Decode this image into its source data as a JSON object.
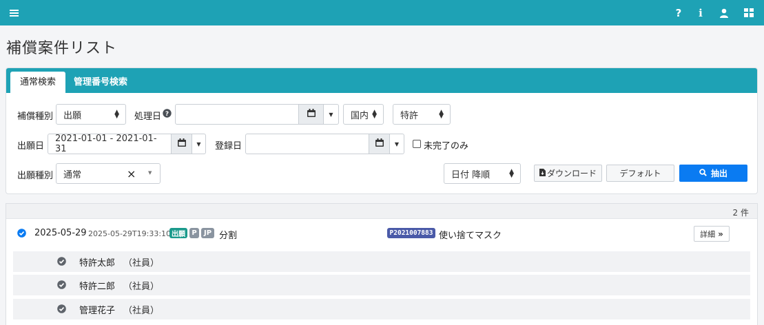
{
  "nav": {
    "icons": [
      "menu-icon",
      "help-icon",
      "info-icon",
      "user-icon",
      "apps-icon"
    ],
    "bg_color": "#1ea2b5"
  },
  "page_title": "補償案件リスト",
  "tabs": [
    {
      "label": "通常検索",
      "active": true
    },
    {
      "label": "管理番号検索",
      "active": false
    }
  ],
  "search": {
    "comp_type_label": "補償種別",
    "comp_type_value": "出願",
    "proc_date_label": "処理日",
    "proc_date_value": "",
    "region_value": "国内",
    "right_type_value": "特許",
    "app_date_label": "出願日",
    "app_date_value": "2021-01-01 - 2021-01-31",
    "reg_date_label": "登録日",
    "reg_date_value": "",
    "incomplete_label": "未完了のみ",
    "incomplete_checked": false,
    "app_type_label": "出願種別",
    "app_type_value": "通常",
    "sort_value": "日付 降順",
    "download_label": "ダウンロード",
    "default_label": "デフォルト",
    "extract_label": "抽出"
  },
  "results": {
    "count": "2 件",
    "item": {
      "date": "2025-05-29",
      "timestamp": "2025-05-29T19:33:10",
      "badges": [
        {
          "text": "出願",
          "color": "#1b9a8c"
        },
        {
          "text": "P",
          "color": "#8a94a0"
        },
        {
          "text": "JP",
          "color": "#8a94a0"
        }
      ],
      "type": "分割",
      "number": "P2021007883",
      "number_color": "#4a5aa8",
      "title": "使い捨てマスク",
      "detail_label": "詳細"
    },
    "persons": [
      {
        "name": "特許太郎",
        "role": "（社員）"
      },
      {
        "name": "特許二郎",
        "role": "（社員）"
      },
      {
        "name": "管理花子",
        "role": "（社員）"
      }
    ]
  }
}
